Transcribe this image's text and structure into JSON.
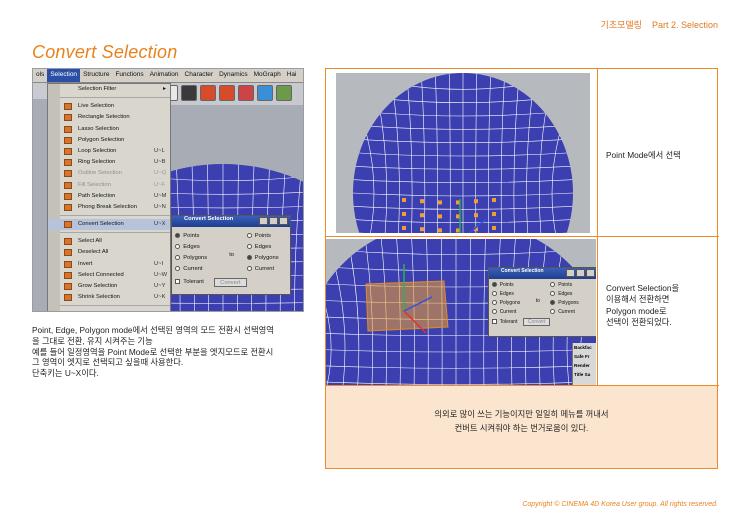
{
  "header": {
    "section": "기초모델링",
    "part": "Part 2. Selection"
  },
  "page_title": "Convert Selection",
  "app": {
    "menubar": [
      "ols",
      "Selection",
      "Structure",
      "Functions",
      "Animation",
      "Character",
      "Dynamics",
      "MoGraph",
      "Hai"
    ],
    "selection_menu": [
      {
        "label": "Selection Filter",
        "shortcut": "",
        "state": "submenu"
      },
      {
        "label": "",
        "shortcut": "",
        "state": "sep"
      },
      {
        "label": "Live Selection",
        "shortcut": "",
        "state": "normal"
      },
      {
        "label": "Rectangle Selection",
        "shortcut": "",
        "state": "normal"
      },
      {
        "label": "Lasso Selection",
        "shortcut": "",
        "state": "normal"
      },
      {
        "label": "Polygon Selection",
        "shortcut": "",
        "state": "normal"
      },
      {
        "label": "Loop Selection",
        "shortcut": "U~L",
        "state": "normal"
      },
      {
        "label": "Ring Selection",
        "shortcut": "U~B",
        "state": "normal"
      },
      {
        "label": "Outline Selection",
        "shortcut": "U~Q",
        "state": "disabled"
      },
      {
        "label": "Fill Selection",
        "shortcut": "U~F",
        "state": "disabled"
      },
      {
        "label": "Path Selection",
        "shortcut": "U~M",
        "state": "normal"
      },
      {
        "label": "Phong Break Selection",
        "shortcut": "U~N",
        "state": "normal"
      },
      {
        "label": "",
        "shortcut": "",
        "state": "sep"
      },
      {
        "label": "Convert Selection",
        "shortcut": "U~X",
        "state": "highlight"
      },
      {
        "label": "",
        "shortcut": "",
        "state": "sep"
      },
      {
        "label": "Select All",
        "shortcut": "",
        "state": "normal"
      },
      {
        "label": "Deselect All",
        "shortcut": "",
        "state": "normal"
      },
      {
        "label": "Invert",
        "shortcut": "U~I",
        "state": "normal"
      },
      {
        "label": "Select Connected",
        "shortcut": "U~W",
        "state": "normal"
      },
      {
        "label": "Grow Selection",
        "shortcut": "U~Y",
        "state": "normal"
      },
      {
        "label": "Shrink Selection",
        "shortcut": "U~K",
        "state": "normal"
      },
      {
        "label": "",
        "shortcut": "",
        "state": "sep"
      },
      {
        "label": "Hide Selected",
        "shortcut": "",
        "state": "normal"
      },
      {
        "label": "Hide Unselected",
        "shortcut": "",
        "state": "normal"
      }
    ],
    "dialog": {
      "title": "Convert Selection",
      "left_options": [
        "Points",
        "Edges",
        "Polygons",
        "Current"
      ],
      "right_options": [
        "Points",
        "Edges",
        "Polygons",
        "Current"
      ],
      "to_label": "to",
      "tolerant_label": "Tolerant",
      "convert_button": "Convert",
      "left_selected": "Points",
      "right_selected": "Polygons"
    },
    "side_panel_items": [
      "Backfac",
      "Safe Fr",
      "Render",
      "Title Sa"
    ]
  },
  "description": [
    "Point, Edge, Polygon mode에서 선택된 영역의 모드 전환시 선택영역",
    "을 그대로 전환, 유지 시켜주는 기능",
    "예를 들어 일정영역을 Point Mode로 선택한 부분을 엣지모드로 전환시",
    "그 영역이 엣지로 선택되고 싶을때 사용한다.",
    "단축키는 U~X이다."
  ],
  "table": {
    "caption1": "Point Mode에서 선택",
    "caption2": [
      "Convert Selection을",
      "이용해서 전환하면",
      "Polygon mode로",
      "선택이 전환되었다."
    ],
    "note": [
      "의외로 많이 쓰는 기능이지만 일일히 메뉴를 꺼내서",
      "컨버트 시켜줘야 하는 번거로움이 있다."
    ]
  },
  "footer": "Copyright © CINEMA 4D Korea User group. All rights reserved.",
  "colors": {
    "accent": "#e8821e",
    "note_bg": "#fbe5cf",
    "mesh": "#3b3fb0",
    "selection": "#f0a030"
  }
}
